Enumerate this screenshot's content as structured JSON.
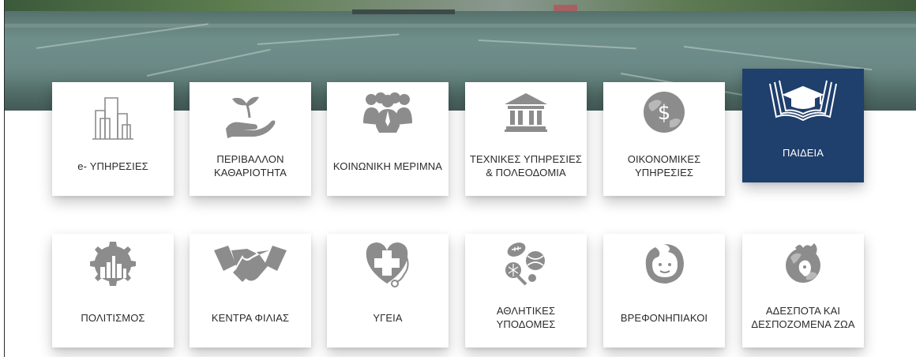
{
  "colors": {
    "accent": "#1f3f6c",
    "icon_gray": "#8c8c8c",
    "label_text": "#2b2b2b",
    "active_text": "#ffffff"
  },
  "services": [
    {
      "id": "e-services",
      "icon": "buildings-icon",
      "lines": [
        "e- ΥΠΗΡΕΣΙΕΣ"
      ]
    },
    {
      "id": "environment",
      "icon": "plant-hand-icon",
      "lines": [
        "ΠΕΡΙΒΑΛΛΟΝ",
        "ΚΑΘΑΡΙΟΤΗΤΑ"
      ]
    },
    {
      "id": "social-care",
      "icon": "people-group-icon",
      "lines": [
        "ΚΟΙΝΩΝΙΚΗ ΜΕΡΙΜΝΑ"
      ]
    },
    {
      "id": "technical",
      "icon": "classical-building-icon",
      "lines": [
        "ΤΕΧΝΙΚΕΣ ΥΠΗΡΕΣΙΕΣ",
        "& ΠΟΛΕΟΔΟΜΙΑ"
      ]
    },
    {
      "id": "financial",
      "icon": "globe-dollar-icon",
      "lines": [
        "ΟΙΚΟΝΟΜΙΚΕΣ",
        "ΥΠΗΡΕΣΙΕΣ"
      ]
    },
    {
      "id": "education",
      "icon": "graduation-book-icon",
      "lines": [
        "ΠΑΙΔΕΙΑ"
      ],
      "active": true
    },
    {
      "id": "culture",
      "icon": "gear-city-icon",
      "lines": [
        "ΠΟΛΙΤΙΣΜΟΣ"
      ]
    },
    {
      "id": "friendship",
      "icon": "handshake-icon",
      "lines": [
        "ΚΕΝΤΡΑ ΦΙΛΙΑΣ"
      ]
    },
    {
      "id": "health",
      "icon": "heart-cross-icon",
      "lines": [
        "ΥΓΕΙΑ"
      ]
    },
    {
      "id": "sports",
      "icon": "sports-balls-icon",
      "lines": [
        "ΑΘΛΗΤΙΚΕΣ",
        "ΥΠΟΔΟΜΕΣ"
      ]
    },
    {
      "id": "nursery",
      "icon": "baby-icon",
      "lines": [
        "ΒΡΕΦΟΝΗΠΙΑΚΟΙ"
      ]
    },
    {
      "id": "animals",
      "icon": "globe-pets-icon",
      "lines": [
        "ΑΔΕΣΠΟΤΑ ΚΑΙ",
        "ΔΕΣΠΟΖΟΜΕΝΑ ΖΩΑ"
      ]
    }
  ]
}
